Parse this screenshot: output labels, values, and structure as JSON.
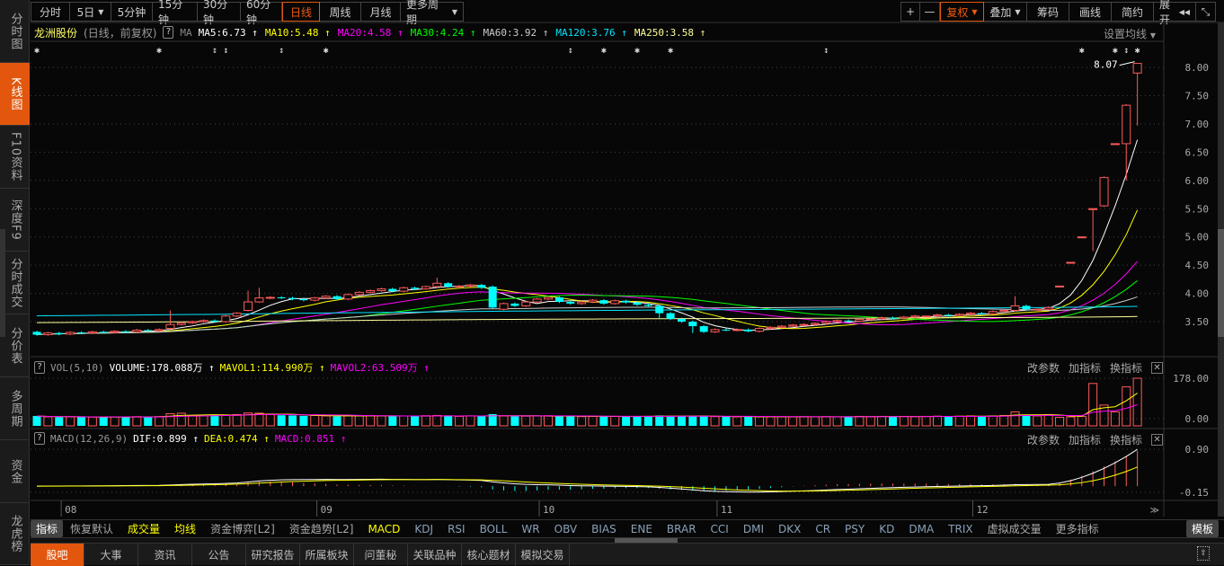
{
  "sidebar": {
    "items": [
      "分时图",
      "K线图",
      "F10资料",
      "深度F9",
      "分时成交",
      "分价表",
      "多周期",
      "资金",
      "龙虎榜"
    ],
    "active": 1
  },
  "toolbar": {
    "periods": [
      "分时",
      "5日",
      "5分钟",
      "15分钟",
      "30分钟",
      "60分钟",
      "日线",
      "周线",
      "月线",
      "更多周期"
    ],
    "active": 6,
    "right": [
      "+",
      "—",
      "复权",
      "叠加",
      "筹码",
      "画线",
      "简约",
      "展开"
    ],
    "collapse_icon": "shrink-icon"
  },
  "header": {
    "stock": "龙洲股份",
    "mode": "(日线，前复权)",
    "q": "?",
    "ma_label": "MA",
    "set_ma": "设置均线",
    "ma": [
      {
        "t": "MA5:6.73",
        "c": "#ffffff"
      },
      {
        "t": "MA10:5.48",
        "c": "#ffff00"
      },
      {
        "t": "MA20:4.58",
        "c": "#ff00ff"
      },
      {
        "t": "MA30:4.24",
        "c": "#00ff00"
      },
      {
        "t": "MA60:3.92",
        "c": "#cccccc"
      },
      {
        "t": "MA120:3.76",
        "c": "#00e5ff"
      },
      {
        "t": "MA250:3.58",
        "c": "#ffff99"
      }
    ],
    "arrow": "↑"
  },
  "vol_header": {
    "label": "VOL(5,10)",
    "items": [
      {
        "t": "VOLUME:178.088万",
        "c": "#ffffff"
      },
      {
        "t": "MAVOL1:114.990万",
        "c": "#ffff00"
      },
      {
        "t": "MAVOL2:63.509万",
        "c": "#ff00ff"
      }
    ]
  },
  "macd_header": {
    "label": "MACD(12,26,9)",
    "items": [
      {
        "t": "DIF:0.899",
        "c": "#ffffff"
      },
      {
        "t": "DEA:0.474",
        "c": "#ffff00"
      },
      {
        "t": "MACD:0.851",
        "c": "#ff00ff"
      }
    ]
  },
  "panel_links": [
    "改参数",
    "加指标",
    "换指标"
  ],
  "price_axis": [
    "8.00",
    "7.50",
    "7.00",
    "6.50",
    "6.00",
    "5.50",
    "5.00",
    "4.50",
    "4.00",
    "3.50"
  ],
  "vol_axis": [
    "178.00",
    "0.00"
  ],
  "macd_axis": [
    "0.90",
    "-0.15"
  ],
  "date_labels": [
    {
      "t": "08",
      "i": 3
    },
    {
      "t": "09",
      "i": 26
    },
    {
      "t": "10",
      "i": 46
    },
    {
      "t": "11",
      "i": 62
    },
    {
      "t": "12",
      "i": 85
    }
  ],
  "max_label": "8.07",
  "markers": [
    {
      "i": 0,
      "s": "✱"
    },
    {
      "i": 11,
      "s": "✱"
    },
    {
      "i": 16,
      "s": "↕"
    },
    {
      "i": 17,
      "s": "↕"
    },
    {
      "i": 22,
      "s": "↕"
    },
    {
      "i": 26,
      "s": "✱"
    },
    {
      "i": 48,
      "s": "↕"
    },
    {
      "i": 51,
      "s": "✱"
    },
    {
      "i": 54,
      "s": "✱"
    },
    {
      "i": 57,
      "s": "✱"
    },
    {
      "i": 71,
      "s": "↕"
    },
    {
      "i": 94,
      "s": "✱"
    },
    {
      "i": 97,
      "s": "✱"
    },
    {
      "i": 98,
      "s": "↕"
    },
    {
      "i": 99,
      "s": "✱"
    }
  ],
  "chart_data": {
    "type": "candlestick",
    "y_range": [
      3.2,
      8.1
    ],
    "close": [
      3.27,
      3.3,
      3.28,
      3.31,
      3.3,
      3.32,
      3.31,
      3.33,
      3.32,
      3.35,
      3.34,
      3.36,
      3.45,
      3.48,
      3.5,
      3.52,
      3.5,
      3.6,
      3.65,
      3.85,
      3.92,
      3.93,
      3.92,
      3.9,
      3.88,
      3.92,
      3.95,
      3.9,
      3.98,
      4.02,
      4.05,
      4.08,
      4.04,
      4.1,
      4.08,
      4.12,
      4.18,
      4.12,
      4.13,
      4.15,
      4.1,
      3.75,
      3.82,
      3.78,
      3.85,
      3.9,
      3.93,
      3.85,
      3.82,
      3.85,
      3.88,
      3.82,
      3.87,
      3.84,
      3.8,
      3.78,
      3.65,
      3.55,
      3.5,
      3.42,
      3.32,
      3.36,
      3.35,
      3.36,
      3.33,
      3.38,
      3.4,
      3.42,
      3.44,
      3.45,
      3.47,
      3.5,
      3.52,
      3.51,
      3.54,
      3.55,
      3.57,
      3.56,
      3.58,
      3.6,
      3.6,
      3.62,
      3.61,
      3.63,
      3.65,
      3.64,
      3.68,
      3.7,
      3.78,
      3.72,
      3.72,
      3.75,
      4.13,
      4.55,
      5.0,
      5.5,
      6.05,
      6.65,
      7.33,
      8.07
    ],
    "open_overrides": {
      "0": 3.32,
      "12": 3.38,
      "19": 3.7,
      "41": 4.12,
      "42": 3.72,
      "92": 4.13,
      "93": 4.55,
      "94": 5.0,
      "95": 5.5,
      "96": 5.55,
      "97": 6.65,
      "98": 6.65,
      "99": 7.9
    },
    "high_overrides": {
      "12": 3.7,
      "19": 4.05,
      "20": 4.1,
      "36": 4.28,
      "88": 3.95,
      "99": 8.07
    },
    "low_overrides": {
      "95": 4.75,
      "98": 6.0,
      "99": 6.97,
      "56": 3.55,
      "59": 3.3
    },
    "volume": [
      12,
      8,
      7,
      8,
      6,
      7,
      6,
      8,
      7,
      9,
      8,
      9,
      22,
      24,
      14,
      12,
      15,
      16,
      18,
      25,
      24,
      18,
      15,
      14,
      12,
      14,
      12,
      10,
      13,
      12,
      14,
      12,
      10,
      12,
      11,
      13,
      14,
      12,
      10,
      12,
      11,
      20,
      12,
      10,
      11,
      12,
      13,
      11,
      10,
      9,
      10,
      11,
      10,
      9,
      10,
      11,
      14,
      12,
      11,
      10,
      12,
      9,
      8,
      8,
      9,
      8,
      9,
      8,
      8,
      9,
      8,
      9,
      8,
      9,
      10,
      9,
      10,
      9,
      10,
      9,
      10,
      11,
      10,
      11,
      12,
      11,
      12,
      14,
      30,
      16,
      12,
      18,
      6,
      8,
      10,
      155,
      60,
      30,
      140,
      178
    ],
    "macd_range": [
      -0.2,
      0.95
    ]
  },
  "indicator_tabs": [
    "指标",
    "恢复默认",
    "成交量",
    "均线",
    "资金博弈[L2]",
    "资金趋势[L2]",
    "MACD",
    "KDJ",
    "RSI",
    "BOLL",
    "WR",
    "OBV",
    "BIAS",
    "ENE",
    "BRAR",
    "CCI",
    "DMI",
    "DKX",
    "CR",
    "PSY",
    "KD",
    "DMA",
    "TRIX",
    "虚拟成交量",
    "更多指标",
    "模板"
  ],
  "bottom_tabs": [
    "股吧",
    "大事",
    "资讯",
    "公告",
    "研究报告",
    "所属板块",
    "问董秘",
    "关联品种",
    "核心题材",
    "模拟交易"
  ],
  "colors": {
    "up": "#ff5a5a",
    "down": "#00ffff",
    "accent": "#e2570d"
  }
}
